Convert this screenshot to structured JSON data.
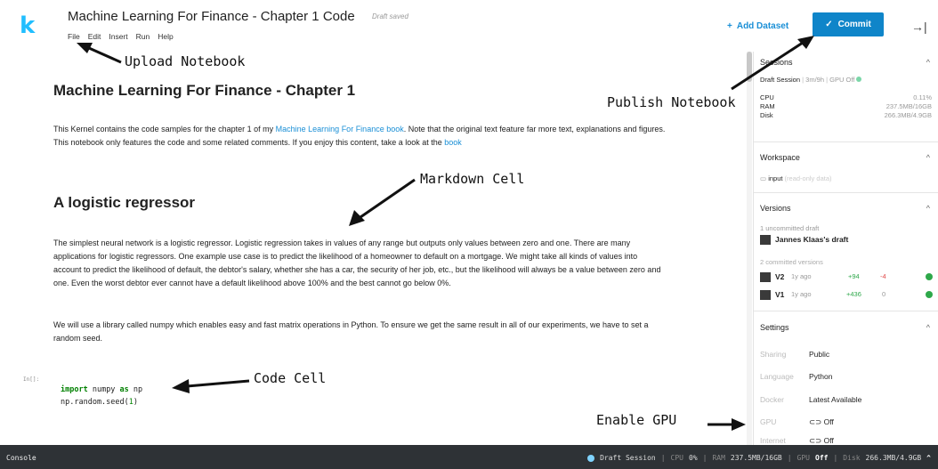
{
  "app": {
    "logo": "k",
    "title": "Machine Learning For Finance - Chapter 1 Code",
    "saved_status": "Draft saved",
    "menu": [
      "File",
      "Edit",
      "Insert",
      "Run",
      "Help"
    ],
    "add_dataset_icon": "+",
    "add_dataset_label": "Add Dataset",
    "commit_icon": "✓",
    "commit_label": "Commit",
    "collapse_icon": "→|"
  },
  "notebook": {
    "h1": "Machine Learning For Finance - Chapter 1",
    "p1_before": "This Kernel contains the code samples for the chapter 1 of my ",
    "p1_link": "Machine Learning For Finance book",
    "p1_after": ". Note that the original text feature far more text, explanations and figures. This notebook only features the code and some related comments. If you enjoy this content, take a look at the ",
    "p1_link2": "book",
    "h2": "A logistic regressor",
    "p2": "The simplest neural network is a logistic regressor. Logistic regression takes in values of any range but outputs only values between zero and one. There are many applications for logistic regressors. One example use case is to predict the likelihood of a homeowner to default on a mortgage. We might take all kinds of values into account to predict the likelihood of default, the debtor's salary, whether she has a car, the security of her job, etc., but the likelihood will always be a value between zero and one. Even the worst debtor ever cannot have a default likelihood above 100% and the best cannot go below 0%.",
    "p3": "We will use a library called numpy which enables easy and fast matrix operations in Python. To ensure we get the same result in all of our experiments, we have to set a random seed.",
    "prompt": "In[]:",
    "code": {
      "kw1": "import",
      "mod": " numpy ",
      "kw2": "as",
      "alias": " np",
      "line2_a": "np.random.seed(",
      "line2_num": "1",
      "line2_b": ")"
    }
  },
  "annotations": {
    "upload": "Upload Notebook",
    "publish": "Publish Notebook",
    "markdown": "Markdown Cell",
    "code": "Code Cell",
    "gpu": "Enable GPU"
  },
  "sidebar": {
    "sessions_title": "Sessions",
    "session_line": "Draft Session",
    "session_time": "3m/9h",
    "session_gpu": "GPU Off",
    "cpu_label": "CPU",
    "cpu_value": "0.11%",
    "ram_label": "RAM",
    "ram_value": "237.5MB/16GB",
    "disk_label": "Disk",
    "disk_value": "266.3MB/4.9GB",
    "workspace_title": "Workspace",
    "folder_icon": "▭",
    "input_label": "input",
    "input_note": "(read-only data)",
    "versions_title": "Versions",
    "uncommitted_label": "1 uncommitted draft",
    "draft_name": "Jannes Klaas's draft",
    "committed_label": "2 committed versions",
    "versions": [
      {
        "name": "V2",
        "age": "1y ago",
        "added": "+94",
        "removed": "-4"
      },
      {
        "name": "V1",
        "age": "1y ago",
        "added": "+436",
        "removed": "0"
      }
    ],
    "settings_title": "Settings",
    "settings": [
      {
        "key": "Sharing",
        "value": "Public"
      },
      {
        "key": "Language",
        "value": "Python"
      },
      {
        "key": "Docker",
        "value": "Latest Available"
      },
      {
        "key": "GPU",
        "value": "Off"
      },
      {
        "key": "Internet",
        "value": "Off"
      }
    ],
    "toggle_icon": "⊂⊃",
    "chevron_icon": "^"
  },
  "statusbar": {
    "console": "Console",
    "session": "Draft Session",
    "cpu_label": "CPU",
    "cpu_value": "0%",
    "ram_label": "RAM",
    "ram_value": "237.5MB/16GB",
    "gpu_label": "GPU",
    "gpu_value": "Off",
    "disk_label": "Disk",
    "disk_value": "266.3MB/4.9GB",
    "sep": "|",
    "expand_icon": "^"
  }
}
